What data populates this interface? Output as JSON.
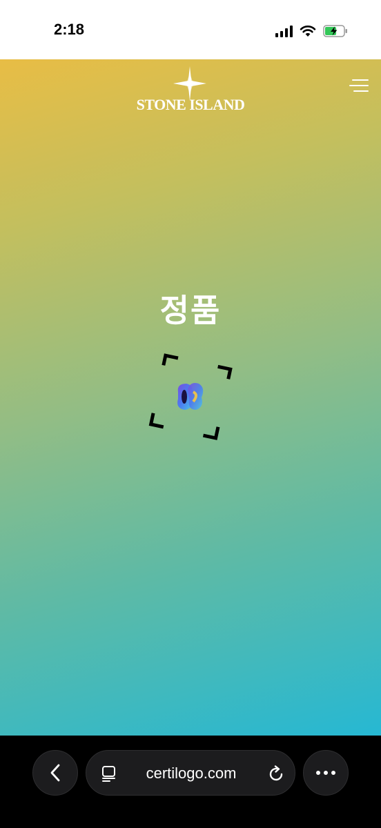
{
  "status_bar": {
    "time": "2:18",
    "icons": [
      "cellular-signal-icon",
      "wifi-icon",
      "battery-charging-icon"
    ]
  },
  "header": {
    "brand": "STONE ISLAND",
    "logo_icon": "compass-star-icon",
    "menu_icon": "menu-icon"
  },
  "main": {
    "heading": "정품",
    "scan_icon": "scan-frame-icon",
    "hologram_icon": "certilogo-hologram-icon"
  },
  "browser": {
    "url": "certilogo.com",
    "back_icon": "chevron-left-icon",
    "tab_icon": "reader-tabs-icon",
    "reload_icon": "reload-icon",
    "more_icon": "more-dots-icon"
  },
  "colors": {
    "gradient_top": "#e8bd45",
    "gradient_mid": "#92bd85",
    "gradient_bottom": "#26b8d3",
    "browser_bg": "#000000",
    "pill_bg": "#1c1c1e"
  }
}
